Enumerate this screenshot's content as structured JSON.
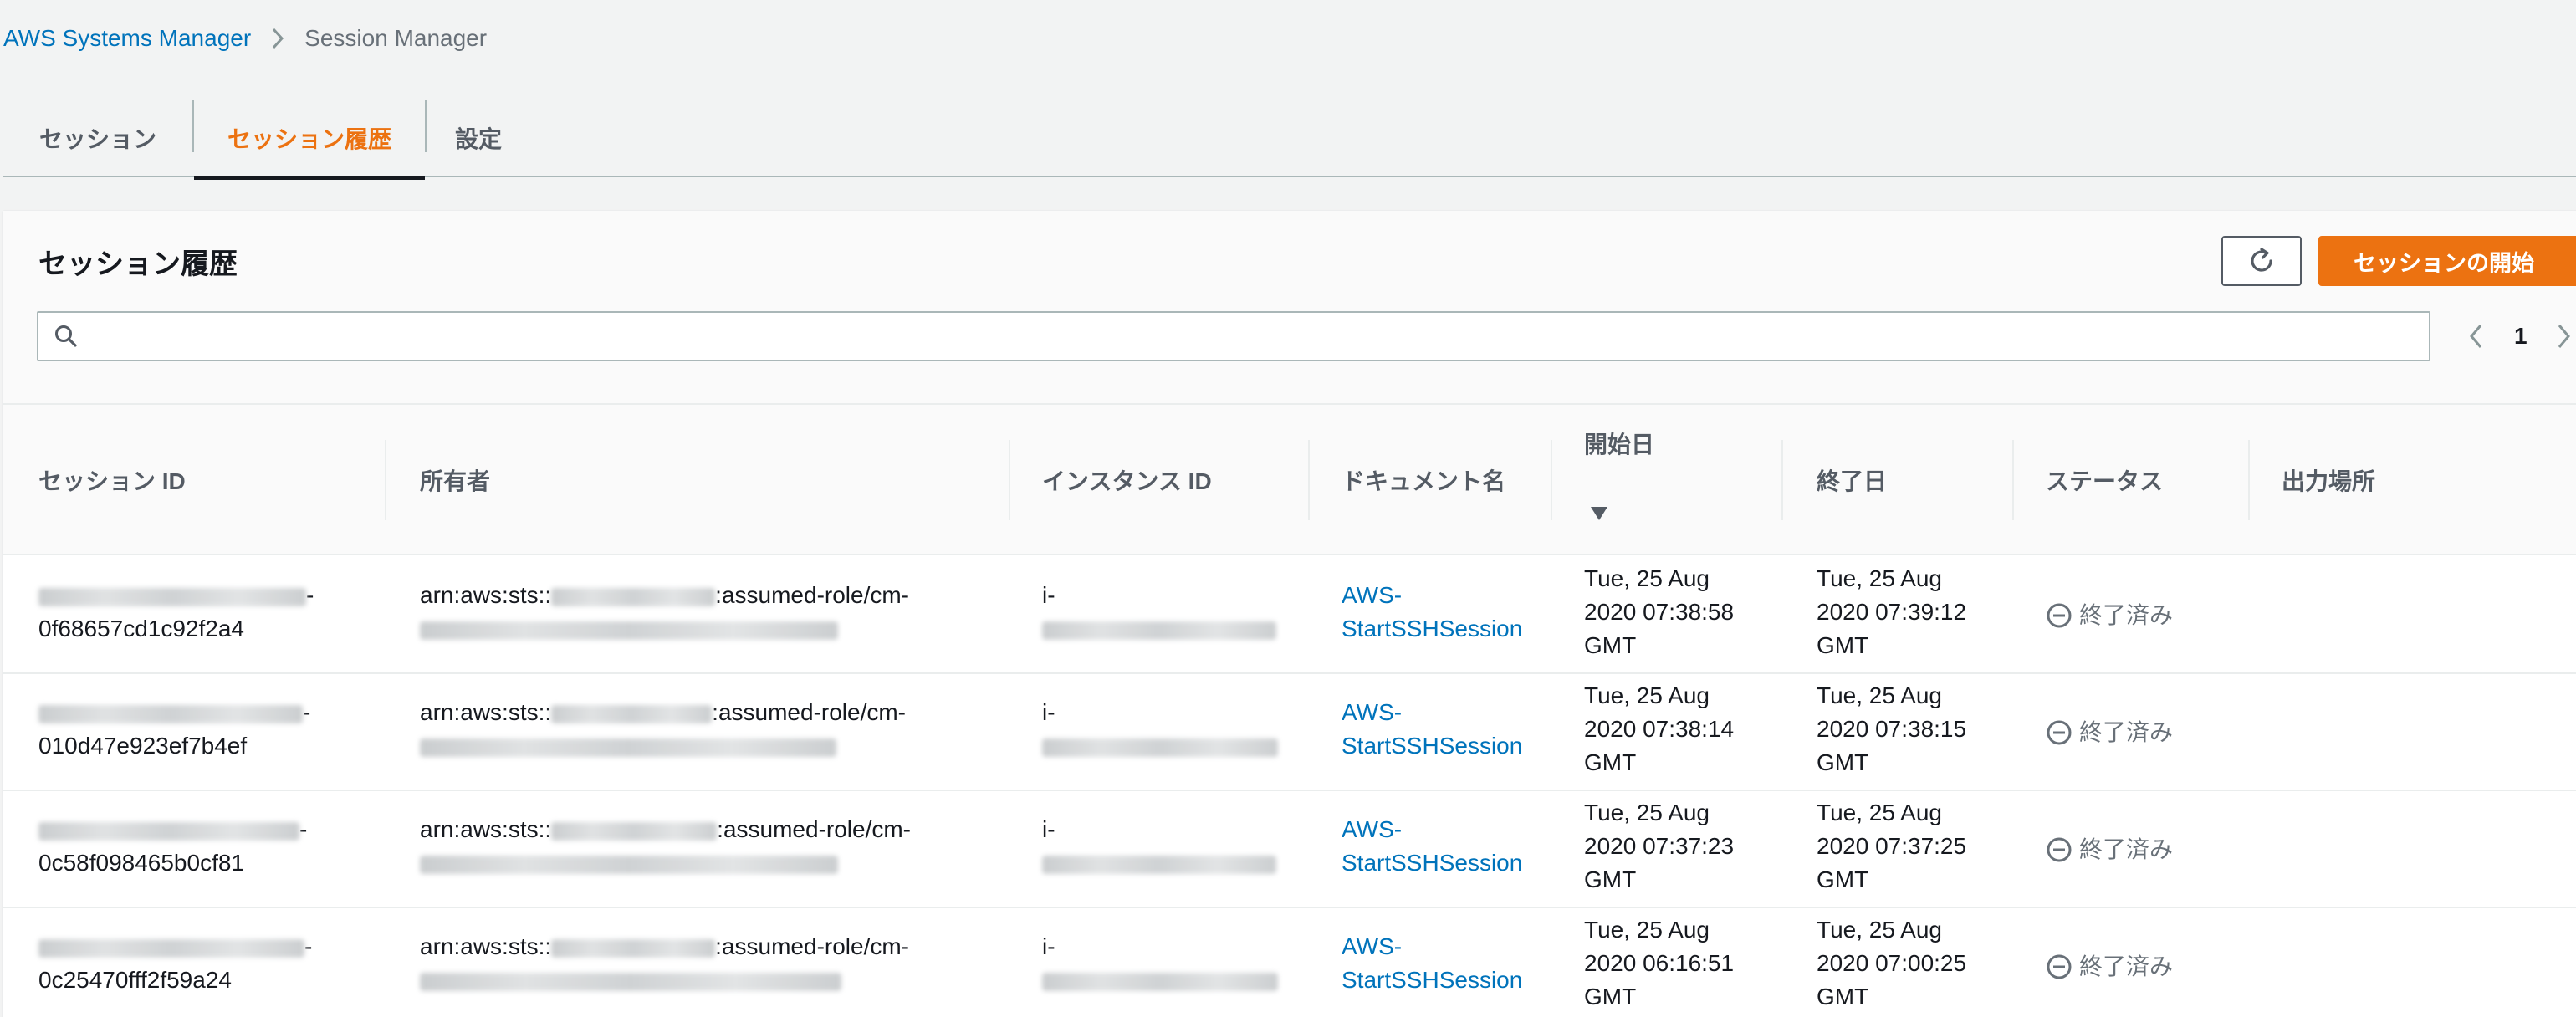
{
  "breadcrumb": {
    "service": "AWS Systems Manager",
    "current": "Session Manager"
  },
  "tabs": [
    {
      "label": "セッション",
      "active": false
    },
    {
      "label": "セッション履歴",
      "active": true
    },
    {
      "label": "設定",
      "active": false
    }
  ],
  "panel": {
    "title": "セッション履歴",
    "refresh_icon": "refresh-icon",
    "start_button": "セッションの開始",
    "search": {
      "value": "",
      "placeholder": ""
    },
    "pagination": {
      "current_page": "1"
    }
  },
  "table": {
    "columns": [
      "セッション ID",
      "所有者",
      "インスタンス ID",
      "ドキュメント名",
      "開始日",
      "終了日",
      "ステータス",
      "出力場所"
    ],
    "sorted_column": "開始日",
    "sort_direction": "descending",
    "rows": [
      {
        "session_id_suffix": "0f68657cd1c92f2a4",
        "owner_prefix": "arn:aws:sts::",
        "owner_middle": ":assumed-role/cm-",
        "instance_prefix": "i-",
        "document": [
          "AWS-",
          "StartSSHSession"
        ],
        "start": [
          "Tue, 25 Aug",
          "2020 07:38:58",
          "GMT"
        ],
        "end": [
          "Tue, 25 Aug",
          "2020 07:39:12",
          "GMT"
        ],
        "status": "終了済み"
      },
      {
        "session_id_suffix": "010d47e923ef7b4ef",
        "owner_prefix": "arn:aws:sts::",
        "owner_middle": ":assumed-role/cm-",
        "instance_prefix": "i-",
        "document": [
          "AWS-",
          "StartSSHSession"
        ],
        "start": [
          "Tue, 25 Aug",
          "2020 07:38:14",
          "GMT"
        ],
        "end": [
          "Tue, 25 Aug",
          "2020 07:38:15",
          "GMT"
        ],
        "status": "終了済み"
      },
      {
        "session_id_suffix": "0c58f098465b0cf81",
        "owner_prefix": "arn:aws:sts::",
        "owner_middle": ":assumed-role/cm-",
        "instance_prefix": "i-",
        "document": [
          "AWS-",
          "StartSSHSession"
        ],
        "start": [
          "Tue, 25 Aug",
          "2020 07:37:23",
          "GMT"
        ],
        "end": [
          "Tue, 25 Aug",
          "2020 07:37:25",
          "GMT"
        ],
        "status": "終了済み"
      },
      {
        "session_id_suffix": "0c25470fff2f59a24",
        "owner_prefix": "arn:aws:sts::",
        "owner_middle": ":assumed-role/cm-",
        "instance_prefix": "i-",
        "document": [
          "AWS-",
          "StartSSHSession"
        ],
        "start": [
          "Tue, 25 Aug",
          "2020 06:16:51",
          "GMT"
        ],
        "end": [
          "Tue, 25 Aug",
          "2020 07:00:25",
          "GMT"
        ],
        "status": "終了済み"
      }
    ]
  },
  "colors": {
    "accent": "#ec7211",
    "link": "#0073bb",
    "text": "#16191f",
    "muted": "#687078",
    "background": "#f2f3f3"
  }
}
